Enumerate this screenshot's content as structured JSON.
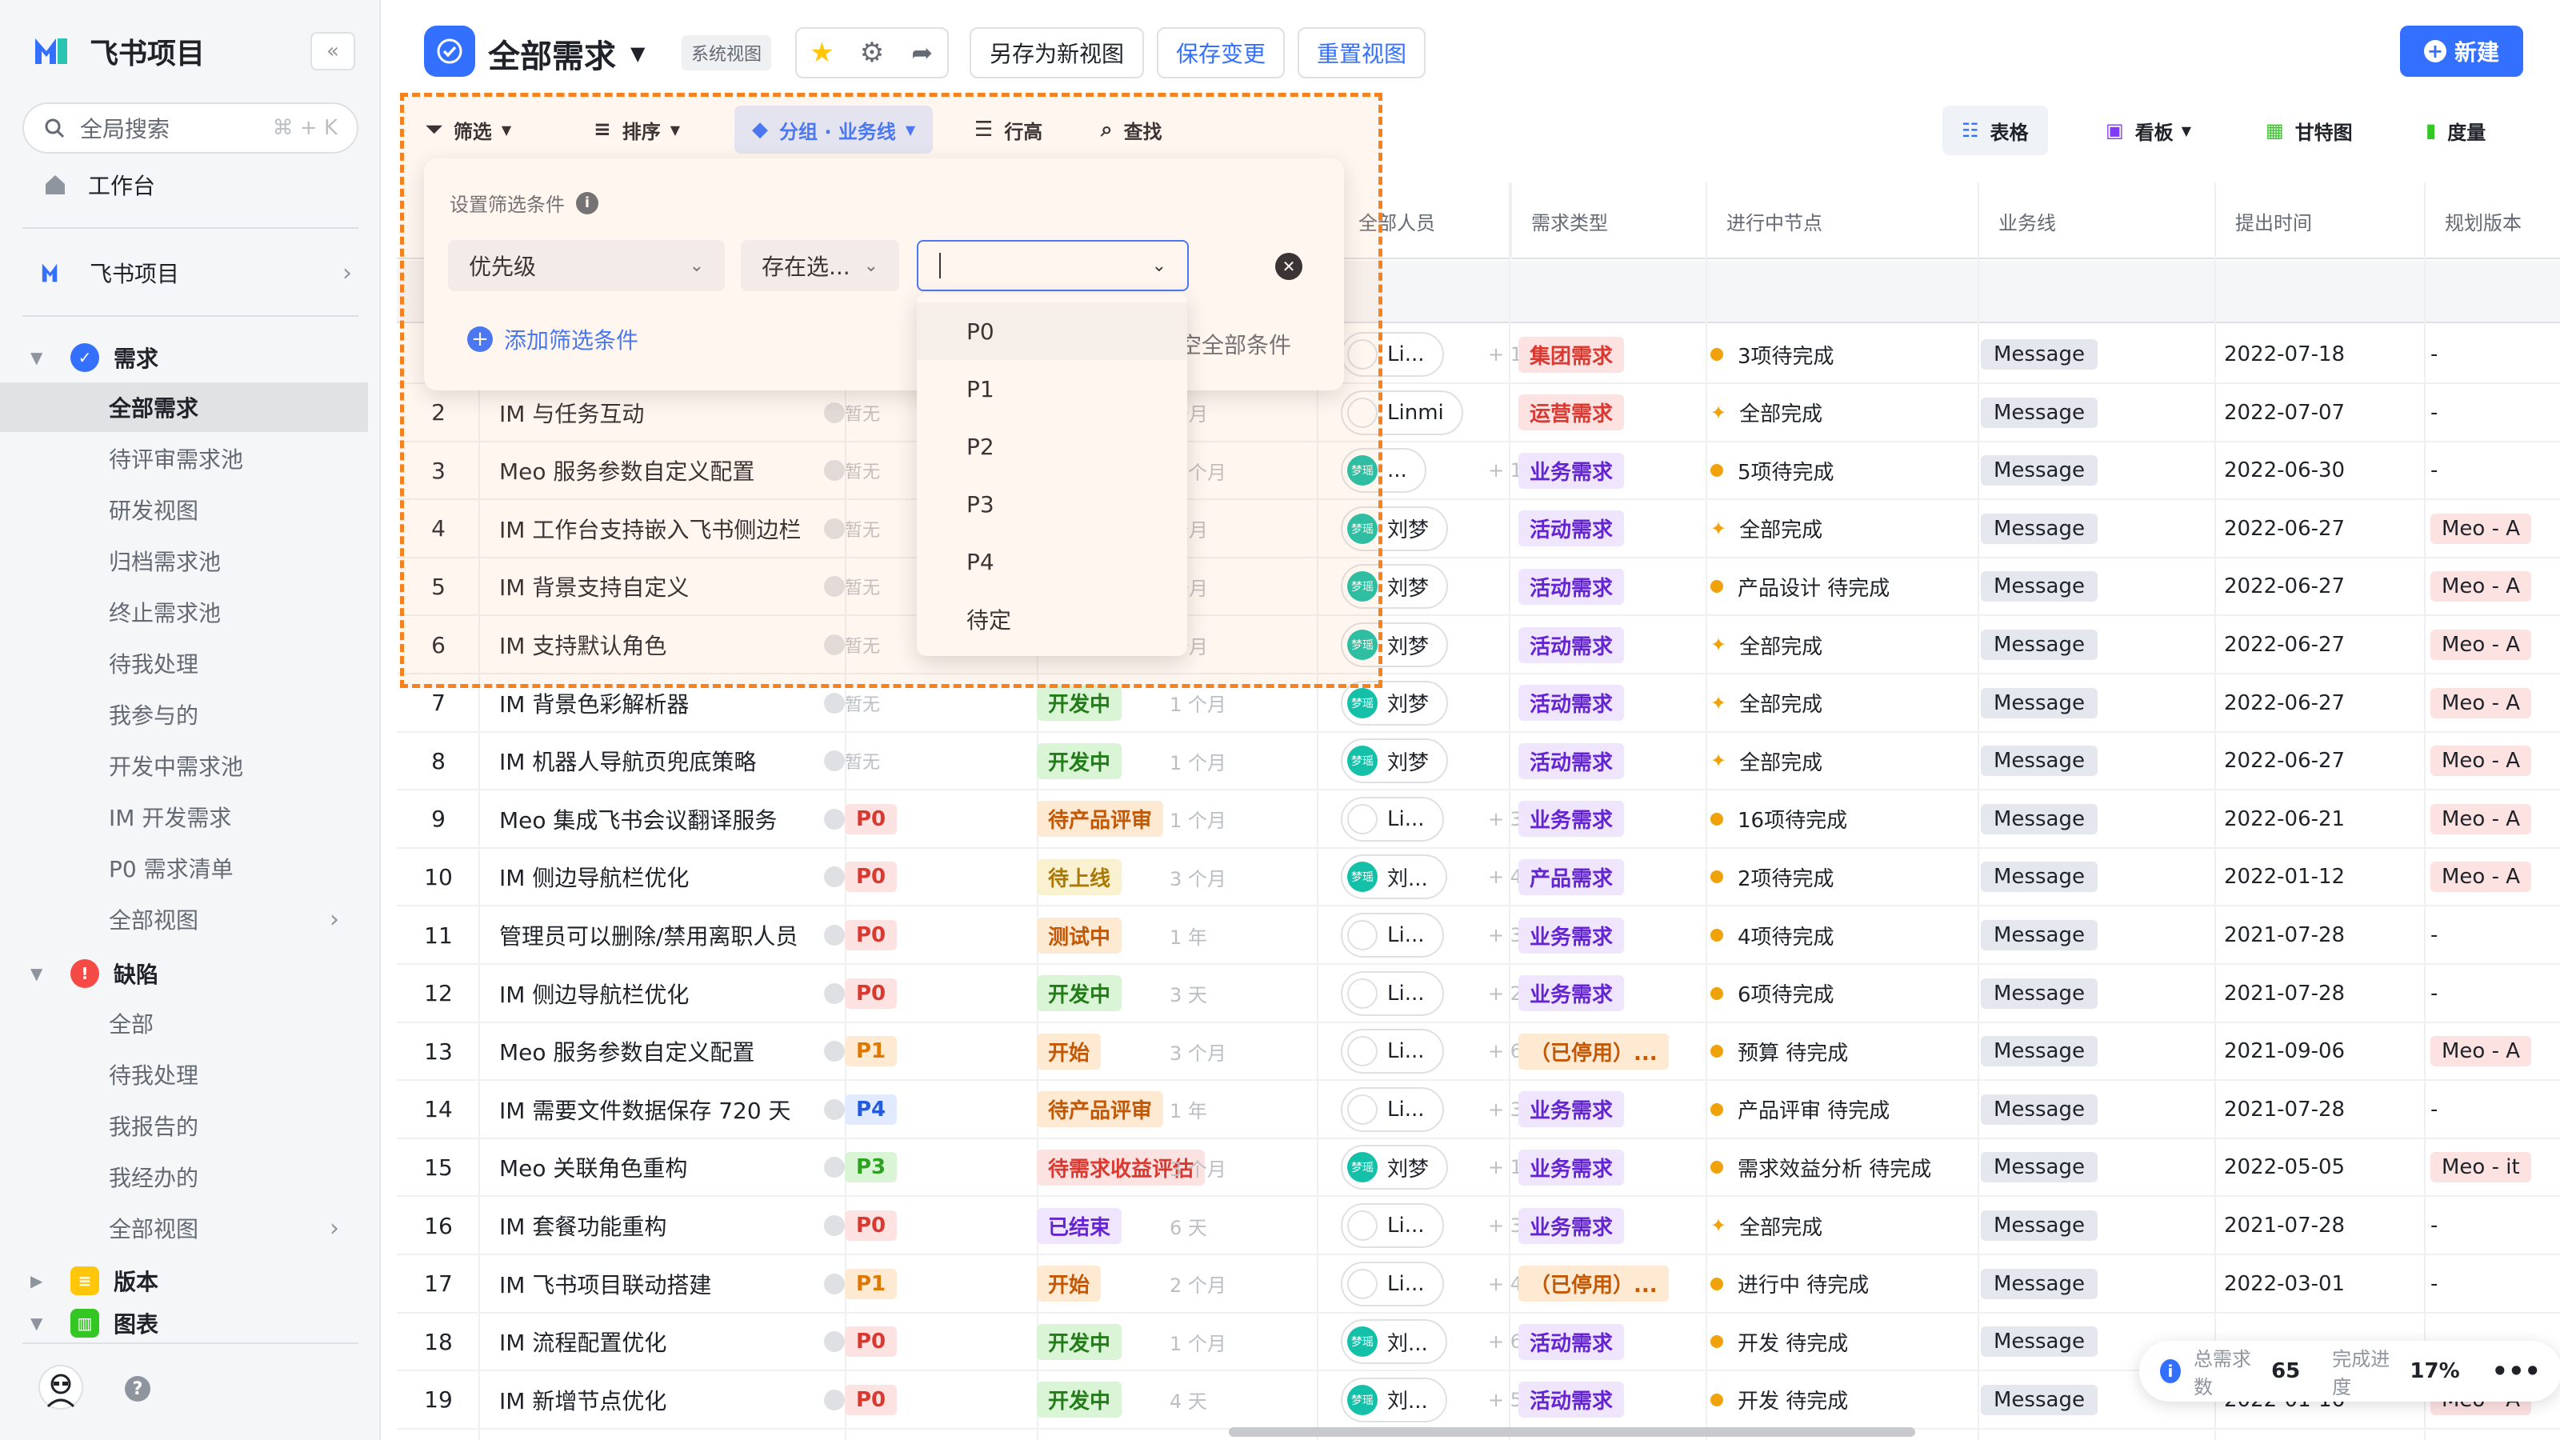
{
  "app": {
    "name": "飞书项目",
    "search_placeholder": "全局搜索",
    "search_shortcut": "⌘ + K",
    "workbench": "工作台",
    "project": "飞书项目"
  },
  "sidebar": {
    "req_section": "需求",
    "req_items": [
      "全部需求",
      "待评审需求池",
      "研发视图",
      "归档需求池",
      "终止需求池",
      "待我处理",
      "我参与的",
      "开发中需求池",
      "IM 开发需求",
      "P0 需求清单",
      "全部视图"
    ],
    "bug_section": "缺陷",
    "bug_items": [
      "全部",
      "待我处理",
      "我报告的",
      "我经办的",
      "全部视图"
    ],
    "ver_section": "版本",
    "chart_section": "图表"
  },
  "header": {
    "title": "全部需求",
    "system_view": "系统视图",
    "save_as": "另存为新视图",
    "save_changes": "保存变更",
    "reset_view": "重置视图",
    "new": "新建"
  },
  "toolbar": {
    "filter": "筛选",
    "sort": "排序",
    "group": "分组 · 业务线",
    "row_height": "行高",
    "find": "查找"
  },
  "views": {
    "table": "表格",
    "board": "看板",
    "gantt": "甘特图",
    "metrics": "度量"
  },
  "columns": {
    "people": "全部人员",
    "type": "需求类型",
    "node": "进行中节点",
    "biz": "业务线",
    "time": "提出时间",
    "version": "规划版本"
  },
  "filter_panel": {
    "title": "设置筛选条件",
    "field": "优先级",
    "operator": "存在选...",
    "add": "添加筛选条件",
    "clear": "空全部条件"
  },
  "dropdown_options": [
    "P0",
    "P1",
    "P2",
    "P3",
    "P4",
    "待定"
  ],
  "stats": {
    "total_label": "总需求数",
    "total": "65",
    "progress_label": "完成进度",
    "progress": "17%"
  },
  "rows": [
    {
      "n": "1",
      "title": "",
      "prio": "",
      "status": "",
      "dur": "",
      "person": "Li...",
      "pav": "w",
      "extra": "+ 1",
      "type": "集团需求",
      "tcol": "red",
      "node": "3项待完成",
      "nicon": "dot",
      "biz": "Message",
      "date": "2022-07-18",
      "ver": "-"
    },
    {
      "n": "2",
      "title": "IM 与任务互动",
      "prio": "暂无",
      "status": "",
      "dur": "个月",
      "person": "Linmi",
      "pav": "w",
      "extra": "",
      "type": "运营需求",
      "tcol": "red",
      "node": "全部完成",
      "nicon": "party",
      "biz": "Message",
      "date": "2022-07-07",
      "ver": "-"
    },
    {
      "n": "3",
      "title": "Meo 服务参数自定义配置",
      "prio": "暂无",
      "status": "",
      "dur": "1 个月",
      "person": "...",
      "pav": "g",
      "extra": "+ 10",
      "type": "业务需求",
      "tcol": "purple",
      "node": "5项待完成",
      "nicon": "dot",
      "biz": "Message",
      "date": "2022-06-30",
      "ver": "-"
    },
    {
      "n": "4",
      "title": "IM 工作台支持嵌入飞书侧边栏",
      "prio": "暂无",
      "status": "",
      "dur": "个月",
      "person": "刘梦",
      "pav": "g",
      "extra": "",
      "type": "活动需求",
      "tcol": "purple",
      "node": "全部完成",
      "nicon": "party",
      "biz": "Message",
      "date": "2022-06-27",
      "ver": "Meo - A"
    },
    {
      "n": "5",
      "title": "IM 背景支持自定义",
      "prio": "暂无",
      "status": "",
      "dur": "个月",
      "person": "刘梦",
      "pav": "g",
      "extra": "",
      "type": "活动需求",
      "tcol": "purple",
      "node": "产品设计 待完成",
      "nicon": "dot",
      "biz": "Message",
      "date": "2022-06-27",
      "ver": "Meo - A"
    },
    {
      "n": "6",
      "title": "IM 支持默认角色",
      "prio": "暂无",
      "status": "",
      "dur": "个月",
      "person": "刘梦",
      "pav": "g",
      "extra": "",
      "type": "活动需求",
      "tcol": "purple",
      "node": "全部完成",
      "nicon": "party",
      "biz": "Message",
      "date": "2022-06-27",
      "ver": "Meo - A"
    },
    {
      "n": "7",
      "title": "IM 背景色彩解析器",
      "prio": "暂无",
      "status": "开发中",
      "scol": "green",
      "dur": "1 个月",
      "person": "刘梦",
      "pav": "g",
      "extra": "",
      "type": "活动需求",
      "tcol": "purple",
      "node": "全部完成",
      "nicon": "party",
      "biz": "Message",
      "date": "2022-06-27",
      "ver": "Meo - A"
    },
    {
      "n": "8",
      "title": "IM 机器人导航页兜底策略",
      "prio": "暂无",
      "status": "开发中",
      "scol": "green",
      "dur": "1 个月",
      "person": "刘梦",
      "pav": "g",
      "extra": "",
      "type": "活动需求",
      "tcol": "purple",
      "node": "全部完成",
      "nicon": "party",
      "biz": "Message",
      "date": "2022-06-27",
      "ver": "Meo - A"
    },
    {
      "n": "9",
      "title": "Meo 集成飞书会议翻译服务",
      "prio": "P0",
      "status": "待产品评审",
      "scol": "orange",
      "dur": "1 个月",
      "person": "Li...",
      "pav": "w",
      "extra": "+ 3",
      "type": "业务需求",
      "tcol": "purple",
      "node": "16项待完成",
      "nicon": "dot",
      "biz": "Message",
      "date": "2022-06-21",
      "ver": "Meo - A"
    },
    {
      "n": "10",
      "title": "IM 侧边导航栏优化",
      "prio": "P0",
      "status": "待上线",
      "scol": "yellow",
      "dur": "3 个月",
      "person": "刘...",
      "pav": "g",
      "extra": "+ 4",
      "type": "产品需求",
      "tcol": "purple",
      "node": "2项待完成",
      "nicon": "dot",
      "biz": "Message",
      "date": "2022-01-12",
      "ver": "Meo - A"
    },
    {
      "n": "11",
      "title": "管理员可以删除/禁用离职人员",
      "prio": "P0",
      "status": "测试中",
      "scol": "orange",
      "dur": "1 年",
      "person": "Li...",
      "pav": "w",
      "extra": "+ 3",
      "type": "业务需求",
      "tcol": "purple",
      "node": "4项待完成",
      "nicon": "dot",
      "biz": "Message",
      "date": "2021-07-28",
      "ver": "-"
    },
    {
      "n": "12",
      "title": "IM 侧边导航栏优化",
      "prio": "P0",
      "status": "开发中",
      "scol": "green",
      "dur": "3 天",
      "person": "Li...",
      "pav": "w",
      "extra": "+ 2",
      "type": "业务需求",
      "tcol": "purple",
      "node": "6项待完成",
      "nicon": "dot",
      "biz": "Message",
      "date": "2021-07-28",
      "ver": "-"
    },
    {
      "n": "13",
      "title": "Meo 服务参数自定义配置",
      "prio": "P1",
      "status": "开始",
      "scol": "orange",
      "dur": "3 个月",
      "person": "Li...",
      "pav": "w",
      "extra": "+ 6",
      "type": "（已停用）...",
      "tcol": "orange",
      "node": "预算 待完成",
      "nicon": "dot",
      "biz": "Message",
      "date": "2021-09-06",
      "ver": "Meo - A"
    },
    {
      "n": "14",
      "title": "IM 需要文件数据保存 720 天",
      "prio": "P4",
      "status": "待产品评审",
      "scol": "orange",
      "dur": "1 年",
      "person": "Li...",
      "pav": "w",
      "extra": "+ 3",
      "type": "业务需求",
      "tcol": "purple",
      "node": "产品评审 待完成",
      "nicon": "dot",
      "biz": "Message",
      "date": "2021-07-28",
      "ver": "-"
    },
    {
      "n": "15",
      "title": "Meo 关联角色重构",
      "prio": "P3",
      "status": "待需求收益评估",
      "scol": "red",
      "dur": "3 个月",
      "person": "刘梦",
      "pav": "g",
      "extra": "+ 1",
      "type": "业务需求",
      "tcol": "purple",
      "node": "需求效益分析 待完成",
      "nicon": "dot",
      "biz": "Message",
      "date": "2022-05-05",
      "ver": "Meo - it"
    },
    {
      "n": "16",
      "title": "IM 套餐功能重构",
      "prio": "P0",
      "status": "已结束",
      "scol": "purple",
      "dur": "6 天",
      "person": "Li...",
      "pav": "w",
      "extra": "+ 3",
      "type": "业务需求",
      "tcol": "purple",
      "node": "全部完成",
      "nicon": "party",
      "biz": "Message",
      "date": "2021-07-28",
      "ver": "-"
    },
    {
      "n": "17",
      "title": "IM 飞书项目联动搭建",
      "prio": "P1",
      "status": "开始",
      "scol": "orange",
      "dur": "2 个月",
      "person": "Li...",
      "pav": "w",
      "extra": "+ 4",
      "type": "（已停用）...",
      "tcol": "orange",
      "node": "进行中 待完成",
      "nicon": "dot",
      "biz": "Message",
      "date": "2022-03-01",
      "ver": "-"
    },
    {
      "n": "18",
      "title": "IM 流程配置优化",
      "prio": "P0",
      "status": "开发中",
      "scol": "green",
      "dur": "1 个月",
      "person": "刘...",
      "pav": "g",
      "extra": "+ 6",
      "type": "活动需求",
      "tcol": "purple",
      "node": "开发 待完成",
      "nicon": "dot",
      "biz": "Message",
      "date": "",
      "ver": ""
    },
    {
      "n": "19",
      "title": "IM 新增节点优化",
      "prio": "P0",
      "status": "开发中",
      "scol": "green",
      "dur": "4 天",
      "person": "刘...",
      "pav": "g",
      "extra": "+ 5",
      "type": "活动需求",
      "tcol": "purple",
      "node": "开发 待完成",
      "nicon": "dot",
      "biz": "Message",
      "date": "2022-01-16",
      "ver": "Meo - A"
    }
  ]
}
